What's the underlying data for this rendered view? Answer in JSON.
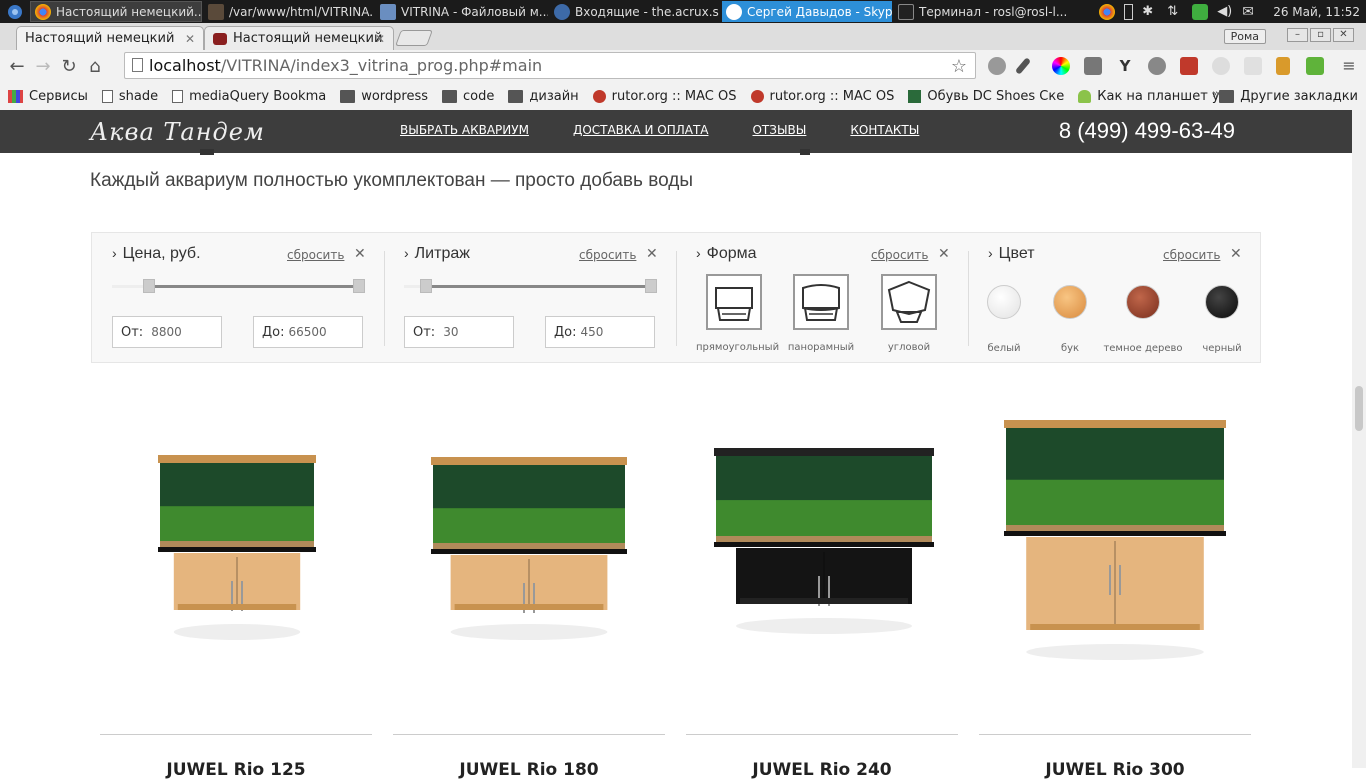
{
  "taskbar": {
    "tasks": [
      "Настоящий немецкий...",
      "/var/www/html/VITRINA...",
      "VITRINA - Файловый м...",
      "Входящие - the.acrux.s...",
      "Сергей Давыдов - Skyp...",
      "Терминал - rosl@rosl-l..."
    ],
    "clock": "26 Май, 11:52"
  },
  "browser": {
    "user": "Рома",
    "tabs": [
      "Настоящий немецкий",
      "Настоящий немецкий"
    ],
    "url_host": "localhost",
    "url_path": "/VITRINA/index3_vitrina_prog.php#main",
    "bookmarks": [
      "Сервисы",
      "shade",
      "mediaQuery Bookma",
      "wordpress",
      "code",
      "дизайн",
      "rutor.org :: MAC OS",
      "rutor.org :: MAC OS",
      "Обувь DC Shoes Ске",
      "Как на планшет уст"
    ],
    "bookmarks_more": "»",
    "other_bookmarks": "Другие закладки"
  },
  "site": {
    "logo": "Аква Тандем",
    "nav": [
      "ВЫБРАТЬ АКВАРИУМ",
      "ДОСТАВКА И ОПЛАТА",
      "ОТЗЫВЫ",
      "КОНТАКТЫ"
    ],
    "phone": "8 (499) 499-63-49",
    "subtitle": "Каждый аквариум полностью укомплектован — просто добавь воды"
  },
  "filters": {
    "reset_label": "сбросить",
    "price": {
      "title": "Цена, руб.",
      "from_label": "От:",
      "from_value": "8800",
      "to_label": "До:",
      "to_value": "66500"
    },
    "volume": {
      "title": "Литраж",
      "from_label": "От:",
      "from_value": "30",
      "to_label": "До:",
      "to_value": "450"
    },
    "shape": {
      "title": "Форма",
      "options": [
        "прямоугольный",
        "панорамный",
        "угловой"
      ]
    },
    "color": {
      "title": "Цвет",
      "options": [
        "белый",
        "бук",
        "темное дерево",
        "черный"
      ]
    }
  },
  "products": [
    {
      "title": "JUWEL Rio 125",
      "cabinet": "#e5b57e",
      "trim": "#c8924f"
    },
    {
      "title": "JUWEL Rio 180",
      "cabinet": "#e5b57e",
      "trim": "#c8924f"
    },
    {
      "title": "JUWEL Rio 240",
      "cabinet": "#141414",
      "trim": "#222222"
    },
    {
      "title": "JUWEL Rio 300",
      "cabinet": "#e5b57e",
      "trim": "#c8924f"
    }
  ],
  "colors": {
    "header_bg": "#3d3d3d",
    "filter_bg": "#f8f8f8"
  }
}
